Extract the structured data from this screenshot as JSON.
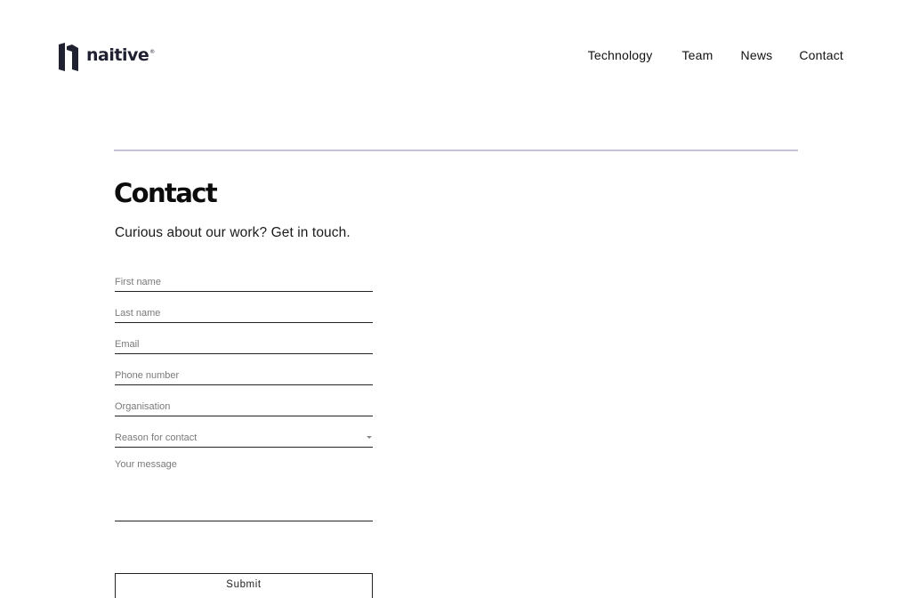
{
  "header": {
    "logo_text": "naitive",
    "logo_reg": "®",
    "brand_color": "#1f2030",
    "nav": {
      "technology": "Technology",
      "team": "Team",
      "news": "News",
      "contact": "Contact"
    }
  },
  "main": {
    "title": "Contact",
    "subtitle": "Curious about our work? Get in touch.",
    "divider_color": "#c6c3d6"
  },
  "form": {
    "first_name": {
      "placeholder": "First name",
      "value": ""
    },
    "last_name": {
      "placeholder": "Last name",
      "value": ""
    },
    "email": {
      "placeholder": "Email",
      "value": ""
    },
    "phone": {
      "placeholder": "Phone number",
      "value": ""
    },
    "organisation": {
      "placeholder": "Organisation",
      "value": ""
    },
    "reason": {
      "label": "Reason for contact",
      "icon": "caret-down-icon"
    },
    "message": {
      "placeholder": "Your message",
      "value": ""
    },
    "submit_label": "Submit"
  }
}
